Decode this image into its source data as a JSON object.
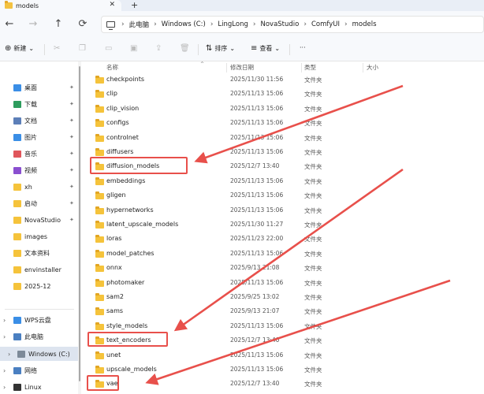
{
  "window": {
    "tab_title": "models",
    "tab_close": "✕",
    "new_tab": "+"
  },
  "nav": {
    "back": "←",
    "forward": "→",
    "up": "↑",
    "refresh": "⟳",
    "breadcrumb_sep": "›",
    "breadcrumbs": [
      "此电脑",
      "Windows (C:)",
      "LingLong",
      "NovaStudio",
      "ComfyUI",
      "models"
    ]
  },
  "commandbar": {
    "new_label": "新建",
    "new_caret": "⌄",
    "sort_label": "排序",
    "sort_caret": "⌄",
    "view_label": "查看",
    "view_caret": "⌄",
    "more_label": "···"
  },
  "sidebar": {
    "pin_glyph": "✦",
    "expand_glyph": "›",
    "items": [
      {
        "label": "桌面",
        "icon": "desktop-icon",
        "color": "#3a8ee6"
      },
      {
        "label": "下载",
        "icon": "download-icon",
        "color": "#2e9c5e"
      },
      {
        "label": "文档",
        "icon": "document-icon",
        "color": "#5c7fb8"
      },
      {
        "label": "图片",
        "icon": "pictures-icon",
        "color": "#3a8ee6"
      },
      {
        "label": "音乐",
        "icon": "music-icon",
        "color": "#e0565b"
      },
      {
        "label": "视频",
        "icon": "video-icon",
        "color": "#8a4fd0"
      },
      {
        "label": "xh",
        "icon": "folder-icon",
        "color": "#f5c33b"
      },
      {
        "label": "启动",
        "icon": "folder-icon",
        "color": "#f5c33b"
      },
      {
        "label": "NovaStudio",
        "icon": "folder-icon",
        "color": "#f5c33b"
      },
      {
        "label": "images",
        "icon": "folder-icon",
        "color": "#f5c33b"
      },
      {
        "label": "文本资料",
        "icon": "folder-icon",
        "color": "#f5c33b"
      },
      {
        "label": "envinstaller",
        "icon": "folder-icon",
        "color": "#f5c33b"
      },
      {
        "label": "2025-12",
        "icon": "folder-icon",
        "color": "#f5c33b"
      }
    ],
    "tree": [
      {
        "label": "WPS云盘",
        "icon": "cloud-icon",
        "color": "#3a8ee6"
      },
      {
        "label": "此电脑",
        "icon": "this-pc-icon",
        "color": "#4a7fc1"
      },
      {
        "label": "Windows (C:)",
        "icon": "drive-icon",
        "color": "#7d8a99"
      },
      {
        "label": "网络",
        "icon": "network-icon",
        "color": "#4a7fc1"
      },
      {
        "label": "Linux",
        "icon": "linux-icon",
        "color": "#333333"
      }
    ]
  },
  "columns": {
    "name": "名称",
    "modified": "修改日期",
    "type": "类型",
    "size": "大小"
  },
  "files": [
    {
      "name": "checkpoints",
      "modified": "2025/11/30 11:56",
      "type": "文件夹"
    },
    {
      "name": "clip",
      "modified": "2025/11/13 15:06",
      "type": "文件夹"
    },
    {
      "name": "clip_vision",
      "modified": "2025/11/13 15:06",
      "type": "文件夹"
    },
    {
      "name": "configs",
      "modified": "2025/11/13 15:06",
      "type": "文件夹"
    },
    {
      "name": "controlnet",
      "modified": "2025/11/13 15:06",
      "type": "文件夹"
    },
    {
      "name": "diffusers",
      "modified": "2025/11/13 15:06",
      "type": "文件夹"
    },
    {
      "name": "diffusion_models",
      "modified": "2025/12/7 13:40",
      "type": "文件夹"
    },
    {
      "name": "embeddings",
      "modified": "2025/11/13 15:06",
      "type": "文件夹"
    },
    {
      "name": "gligen",
      "modified": "2025/11/13 15:06",
      "type": "文件夹"
    },
    {
      "name": "hypernetworks",
      "modified": "2025/11/13 15:06",
      "type": "文件夹"
    },
    {
      "name": "latent_upscale_models",
      "modified": "2025/11/30 11:27",
      "type": "文件夹"
    },
    {
      "name": "loras",
      "modified": "2025/11/23 22:00",
      "type": "文件夹"
    },
    {
      "name": "model_patches",
      "modified": "2025/11/13 15:06",
      "type": "文件夹"
    },
    {
      "name": "onnx",
      "modified": "2025/9/13 21:08",
      "type": "文件夹"
    },
    {
      "name": "photomaker",
      "modified": "2025/11/13 15:06",
      "type": "文件夹"
    },
    {
      "name": "sam2",
      "modified": "2025/9/25 13:02",
      "type": "文件夹"
    },
    {
      "name": "sams",
      "modified": "2025/9/13 21:07",
      "type": "文件夹"
    },
    {
      "name": "style_models",
      "modified": "2025/11/13 15:06",
      "type": "文件夹"
    },
    {
      "name": "text_encoders",
      "modified": "2025/12/7 13:40",
      "type": "文件夹"
    },
    {
      "name": "unet",
      "modified": "2025/11/13 15:06",
      "type": "文件夹"
    },
    {
      "name": "upscale_models",
      "modified": "2025/11/13 15:06",
      "type": "文件夹"
    },
    {
      "name": "vae",
      "modified": "2025/12/7 13:40",
      "type": "文件夹"
    }
  ],
  "annotation_color": "#e8504b"
}
